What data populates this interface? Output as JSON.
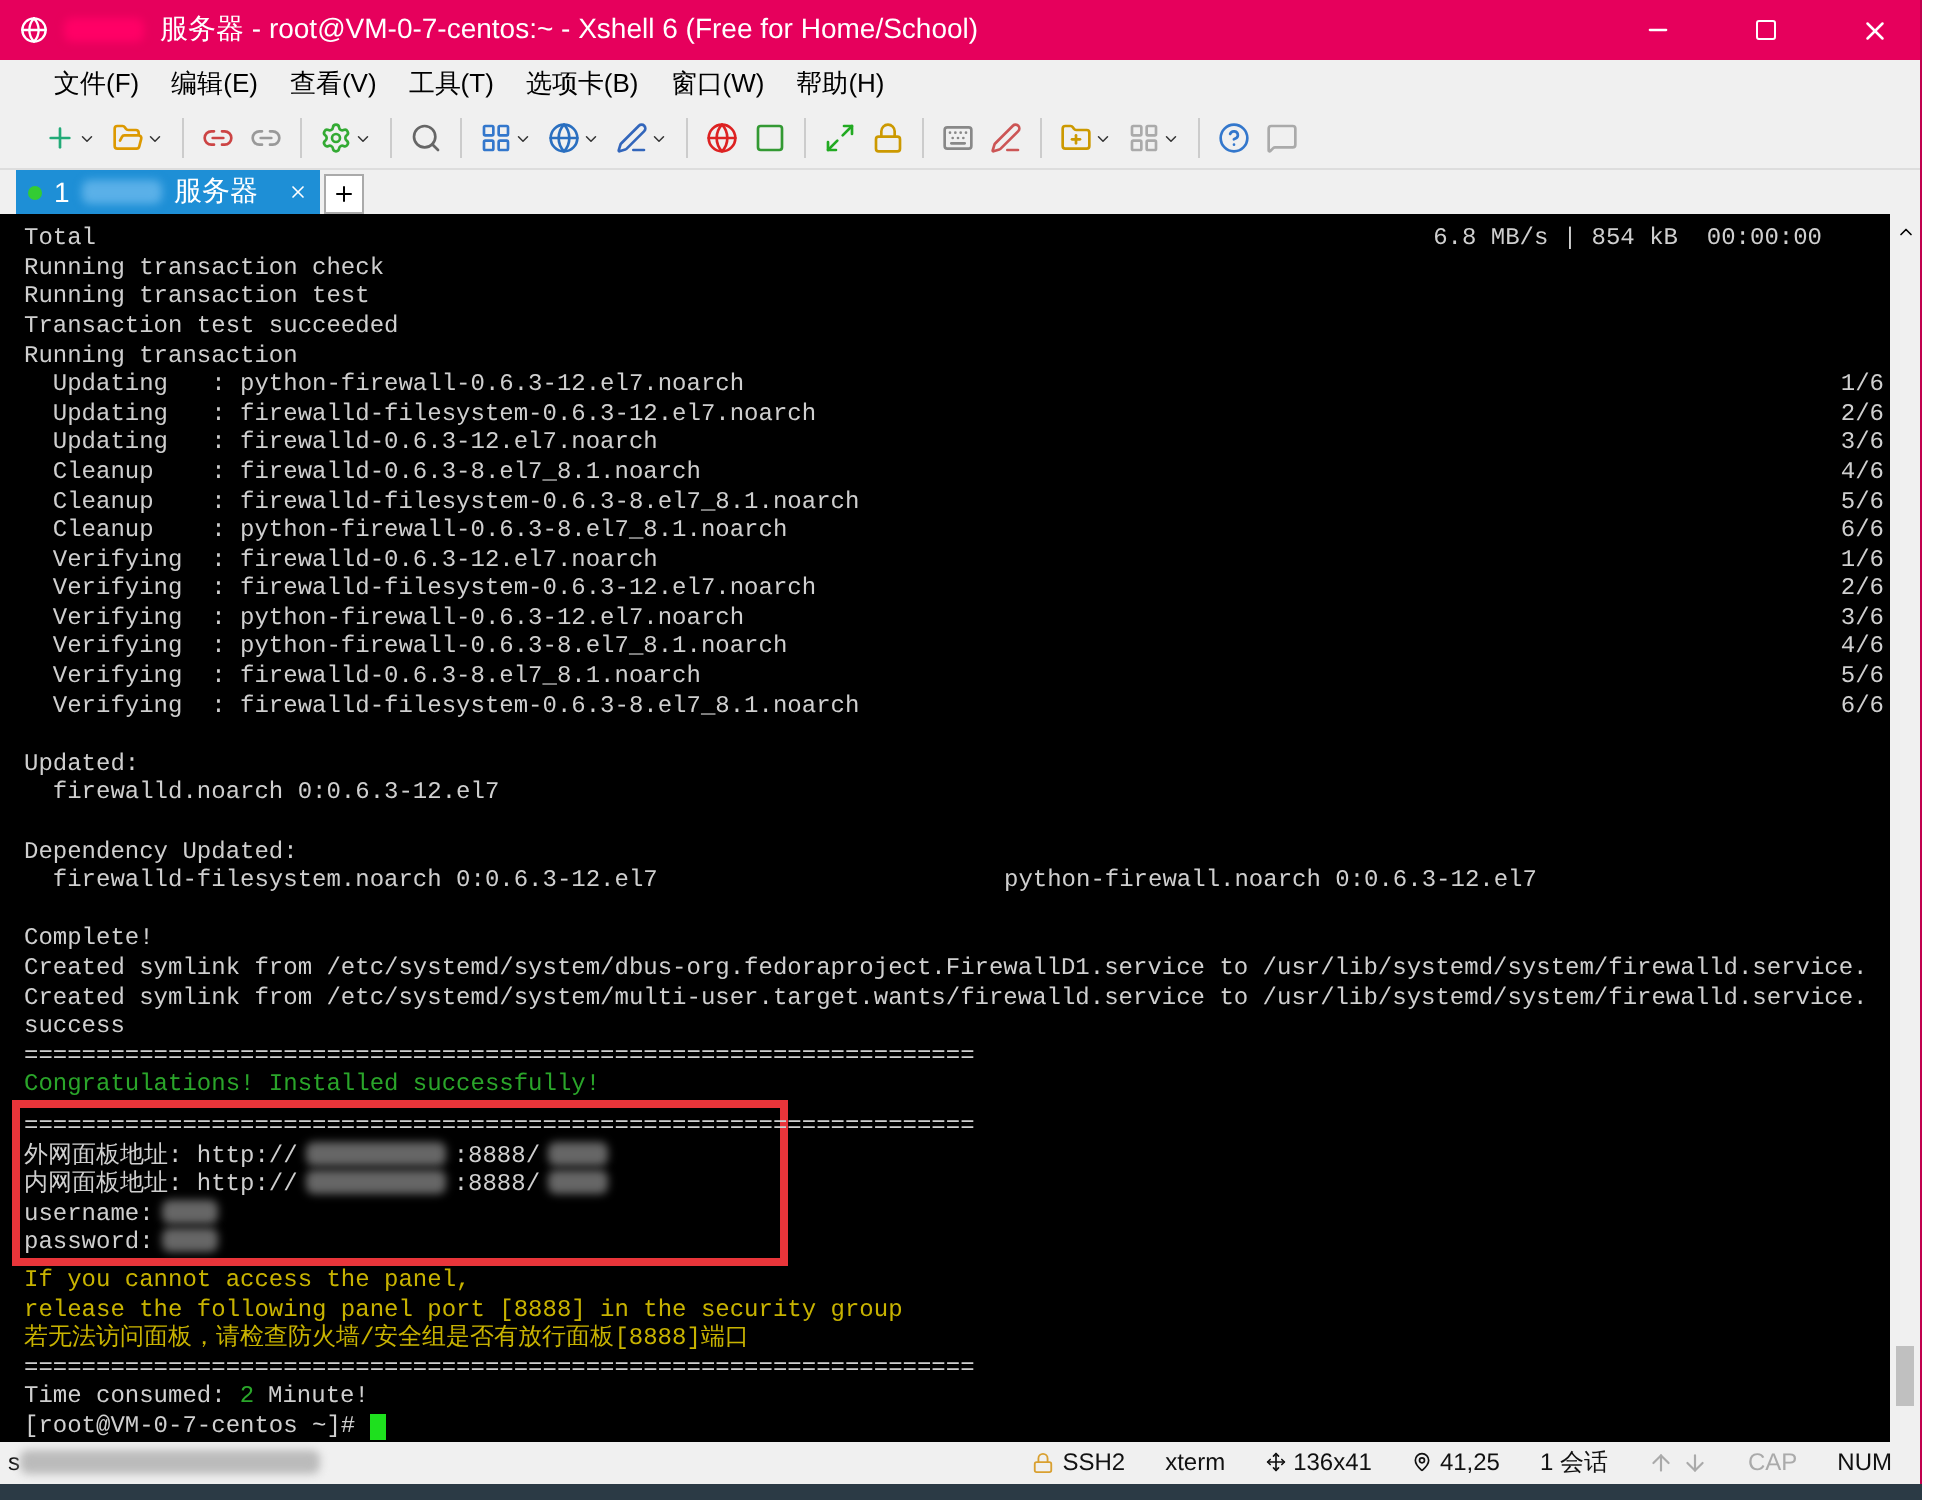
{
  "window": {
    "title": "服务器 - root@VM-0-7-centos:~ - Xshell 6 (Free for Home/School)",
    "title_redacted": true
  },
  "menu": [
    "文件(F)",
    "编辑(E)",
    "查看(V)",
    "工具(T)",
    "选项卡(B)",
    "窗口(W)",
    "帮助(H)"
  ],
  "tabs": [
    {
      "number": "1",
      "label": "服务器",
      "selected": true
    }
  ],
  "terminal": {
    "lines": [
      {
        "kind": "plain",
        "text": "Total",
        "right": "6.8 MB/s | 854 kB  00:00:00"
      },
      {
        "kind": "plain",
        "text": "Running transaction check"
      },
      {
        "kind": "plain",
        "text": "Running transaction test"
      },
      {
        "kind": "plain",
        "text": "Transaction test succeeded"
      },
      {
        "kind": "plain",
        "text": "Running transaction"
      },
      {
        "kind": "plain",
        "text": "  Updating   : python-firewall-0.6.3-12.el7.noarch",
        "right": "1/6"
      },
      {
        "kind": "plain",
        "text": "  Updating   : firewalld-filesystem-0.6.3-12.el7.noarch",
        "right": "2/6"
      },
      {
        "kind": "plain",
        "text": "  Updating   : firewalld-0.6.3-12.el7.noarch",
        "right": "3/6"
      },
      {
        "kind": "plain",
        "text": "  Cleanup    : firewalld-0.6.3-8.el7_8.1.noarch",
        "right": "4/6"
      },
      {
        "kind": "plain",
        "text": "  Cleanup    : firewalld-filesystem-0.6.3-8.el7_8.1.noarch",
        "right": "5/6"
      },
      {
        "kind": "plain",
        "text": "  Cleanup    : python-firewall-0.6.3-8.el7_8.1.noarch",
        "right": "6/6"
      },
      {
        "kind": "plain",
        "text": "  Verifying  : firewalld-0.6.3-12.el7.noarch",
        "right": "1/6"
      },
      {
        "kind": "plain",
        "text": "  Verifying  : firewalld-filesystem-0.6.3-12.el7.noarch",
        "right": "2/6"
      },
      {
        "kind": "plain",
        "text": "  Verifying  : python-firewall-0.6.3-12.el7.noarch",
        "right": "3/6"
      },
      {
        "kind": "plain",
        "text": "  Verifying  : python-firewall-0.6.3-8.el7_8.1.noarch",
        "right": "4/6"
      },
      {
        "kind": "plain",
        "text": "  Verifying  : firewalld-0.6.3-8.el7_8.1.noarch",
        "right": "5/6"
      },
      {
        "kind": "plain",
        "text": "  Verifying  : firewalld-filesystem-0.6.3-8.el7_8.1.noarch",
        "right": "6/6"
      },
      {
        "kind": "blank"
      },
      {
        "kind": "plain",
        "text": "Updated:"
      },
      {
        "kind": "plain",
        "text": "  firewalld.noarch 0:0.6.3-12.el7"
      },
      {
        "kind": "blank"
      },
      {
        "kind": "plain",
        "text": "Dependency Updated:"
      },
      {
        "kind": "plain",
        "text": "  firewalld-filesystem.noarch 0:0.6.3-12.el7",
        "second": "python-firewall.noarch 0:0.6.3-12.el7"
      },
      {
        "kind": "blank"
      },
      {
        "kind": "plain",
        "text": "Complete!"
      },
      {
        "kind": "plain",
        "text": "Created symlink from /etc/systemd/system/dbus-org.fedoraproject.FirewallD1.service to /usr/lib/systemd/system/firewalld.service."
      },
      {
        "kind": "plain",
        "text": "Created symlink from /etc/systemd/system/multi-user.target.wants/firewalld.service to /usr/lib/systemd/system/firewalld.service."
      },
      {
        "kind": "plain",
        "text": "success"
      },
      {
        "kind": "plain",
        "text": "=================================================================="
      },
      {
        "kind": "success",
        "text": "Congratulations! Installed successfully!"
      },
      {
        "kind": "plain",
        "text": "==================================================================",
        "boxed": true
      },
      {
        "kind": "plain",
        "text": "外网面板地址: http://",
        "after": ":8888/",
        "redacted": true,
        "boxed": true
      },
      {
        "kind": "plain",
        "text": "内网面板地址: http://",
        "after": ":8888/",
        "redacted": true,
        "boxed": true
      },
      {
        "kind": "plain",
        "text": "username:",
        "redacted": true,
        "boxed": true
      },
      {
        "kind": "plain",
        "text": "password:",
        "redacted": true,
        "boxed": true
      },
      {
        "kind": "warning",
        "text": "If you cannot access the panel,"
      },
      {
        "kind": "warning",
        "text": "release the following panel port [8888] in the security group"
      },
      {
        "kind": "warning",
        "text": "若无法访问面板，请检查防火墙/安全组是否有放行面板[8888]端口"
      },
      {
        "kind": "plain",
        "text": "=================================================================="
      },
      {
        "kind": "plain",
        "text": "Time consumed:",
        "number": "2",
        "after": "Minute!"
      },
      {
        "kind": "prompt",
        "text": "[root@VM-0-7-centos ~]#"
      }
    ]
  },
  "status_bar": {
    "left": "s",
    "left_redacted": true,
    "protocol": "SSH2",
    "terminal_type": "xterm",
    "size": "136x41",
    "cursor": "41,25",
    "sessions": "1 会话",
    "caps": "CAP",
    "caps_on": false,
    "num": "NUM",
    "num_on": true
  }
}
